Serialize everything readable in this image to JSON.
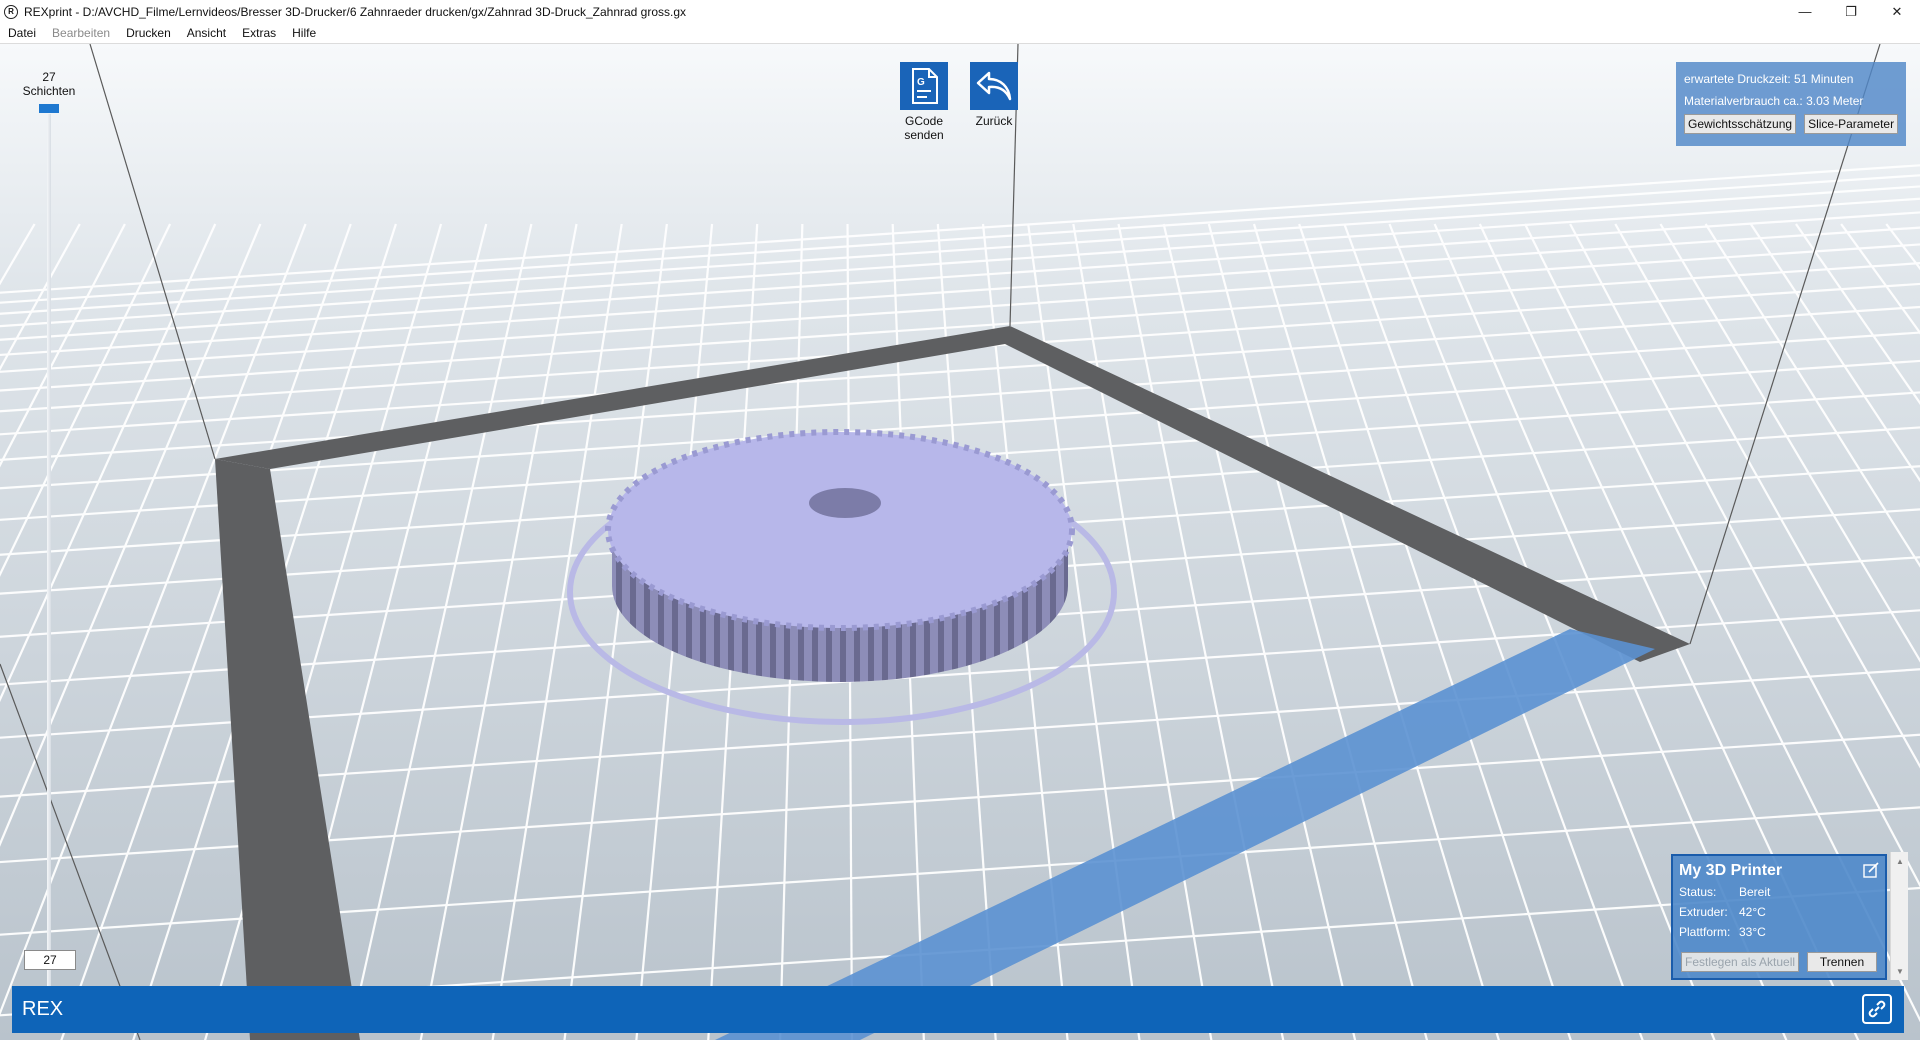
{
  "window": {
    "title": "REXprint - D:/AVCHD_Filme/Lernvideos/Bresser 3D-Drucker/6 Zahnraeder drucken/gx/Zahnrad 3D-Druck_Zahnrad gross.gx",
    "icon": "app-logo-icon",
    "controls": {
      "minimize": "—",
      "restore": "❐",
      "close": "✕"
    }
  },
  "menu": [
    {
      "label": "Datei",
      "enabled": true
    },
    {
      "label": "Bearbeiten",
      "enabled": false
    },
    {
      "label": "Drucken",
      "enabled": true
    },
    {
      "label": "Ansicht",
      "enabled": true
    },
    {
      "label": "Extras",
      "enabled": true
    },
    {
      "label": "Hilfe",
      "enabled": true
    }
  ],
  "layers": {
    "count": "27",
    "unit": "Schichten",
    "input_value": "27"
  },
  "toolbar": {
    "gcode": {
      "line1": "GCode",
      "line2": "senden",
      "icon": "gcode-send-icon"
    },
    "back": {
      "label": "Zurück",
      "icon": "undo-arrow-icon"
    }
  },
  "estimate": {
    "time_label": "erwartete Druckzeit:",
    "time_value": "51 Minuten",
    "material_label": "Materialverbrauch ca.:",
    "material_value": "3.03 Meter",
    "weight_button": "Gewichtsschätzung",
    "slice_button": "Slice-Parameter"
  },
  "printer": {
    "name": "My 3D Printer",
    "status_label": "Status:",
    "status_value": "Bereit",
    "extruder_label": "Extruder:",
    "extruder_value": "42°C",
    "platform_label": "Plattform:",
    "platform_value": "33°C",
    "set_current_button": "Festlegen als Aktuell",
    "disconnect_button": "Trennen"
  },
  "statusbar": {
    "text": "REX"
  },
  "colors": {
    "accent": "#0e64b8",
    "panel": "#5087c8",
    "model": "#b4b4e8",
    "frame": "#5a5a5a",
    "highlight": "#5a90d0"
  }
}
